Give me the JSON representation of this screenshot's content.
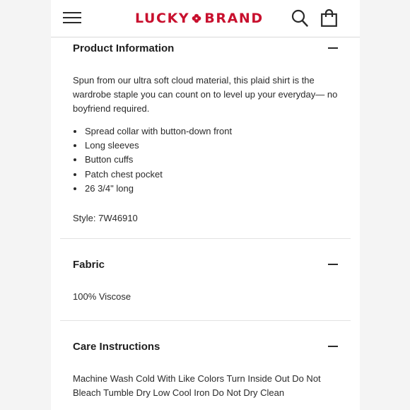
{
  "header": {
    "brand_left": "LUCKY",
    "brand_right": "BRAND",
    "brand_color": "#c8102e",
    "icons": [
      "hamburger-menu-icon",
      "clover-icon",
      "search-icon",
      "shopping-bag-icon"
    ]
  },
  "sections": {
    "product_info": {
      "title": "Product Information",
      "description": "Spun from our ultra soft cloud material, this plaid shirt is the wardrobe staple you can count on to level up your everyday— no boyfriend required.",
      "bullets": [
        "Spread collar with button-down front",
        "Long sleeves",
        "Button cuffs",
        "Patch chest pocket",
        "26 3/4\" long"
      ],
      "style": "Style: 7W46910"
    },
    "fabric": {
      "title": "Fabric",
      "content": "100% Viscose"
    },
    "care": {
      "title": "Care Instructions",
      "content": "Machine Wash Cold With Like Colors Turn Inside Out Do Not Bleach Tumble Dry Low Cool Iron Do Not Dry Clean"
    }
  }
}
